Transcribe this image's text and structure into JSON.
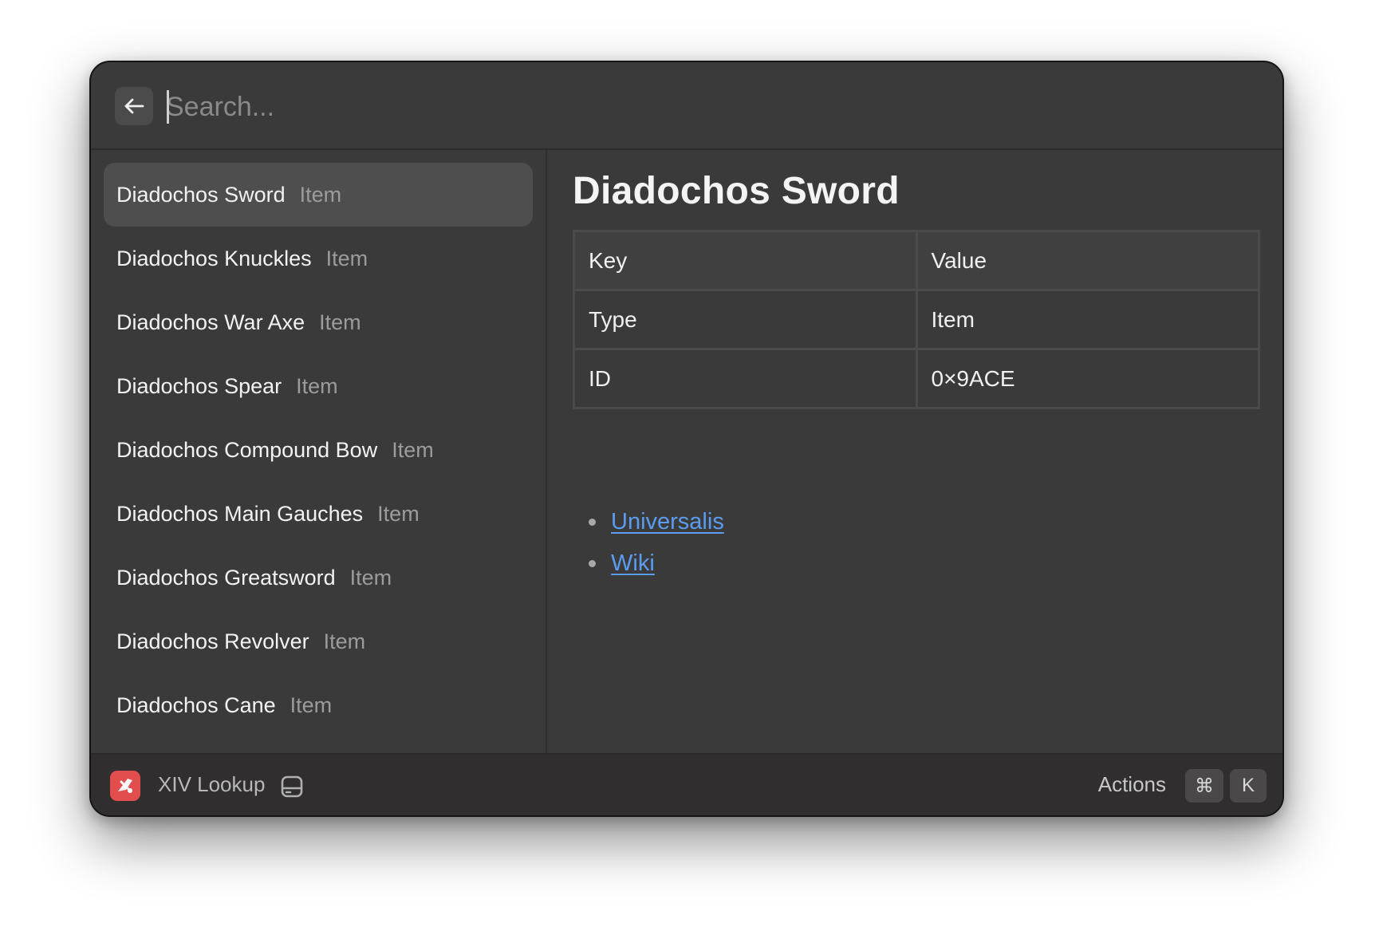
{
  "search": {
    "placeholder": "Search...",
    "value": ""
  },
  "results": [
    {
      "name": "Diadochos Sword",
      "type": "Item"
    },
    {
      "name": "Diadochos Knuckles",
      "type": "Item"
    },
    {
      "name": "Diadochos War Axe",
      "type": "Item"
    },
    {
      "name": "Diadochos Spear",
      "type": "Item"
    },
    {
      "name": "Diadochos Compound Bow",
      "type": "Item"
    },
    {
      "name": "Diadochos Main Gauches",
      "type": "Item"
    },
    {
      "name": "Diadochos Greatsword",
      "type": "Item"
    },
    {
      "name": "Diadochos Revolver",
      "type": "Item"
    },
    {
      "name": "Diadochos Cane",
      "type": "Item"
    }
  ],
  "detail": {
    "title": "Diadochos Sword",
    "table": {
      "headers": [
        "Key",
        "Value"
      ],
      "rows": [
        [
          "Type",
          "Item"
        ],
        [
          "ID",
          "0×9ACE"
        ]
      ]
    },
    "links": [
      "Universalis",
      "Wiki"
    ]
  },
  "footer": {
    "app_name": "XIV Lookup",
    "actions_label": "Actions",
    "shortcut": [
      "⌘",
      "K"
    ]
  },
  "colors": {
    "window_bg": "#3a3a3a",
    "selected_bg": "#4e4e4e",
    "link": "#5c9cf0",
    "app_icon": "#e24d4d"
  },
  "icons": {
    "back": "arrow-left-icon",
    "app": "xiv-lookup-app-icon",
    "storage": "hard-drive-icon"
  }
}
